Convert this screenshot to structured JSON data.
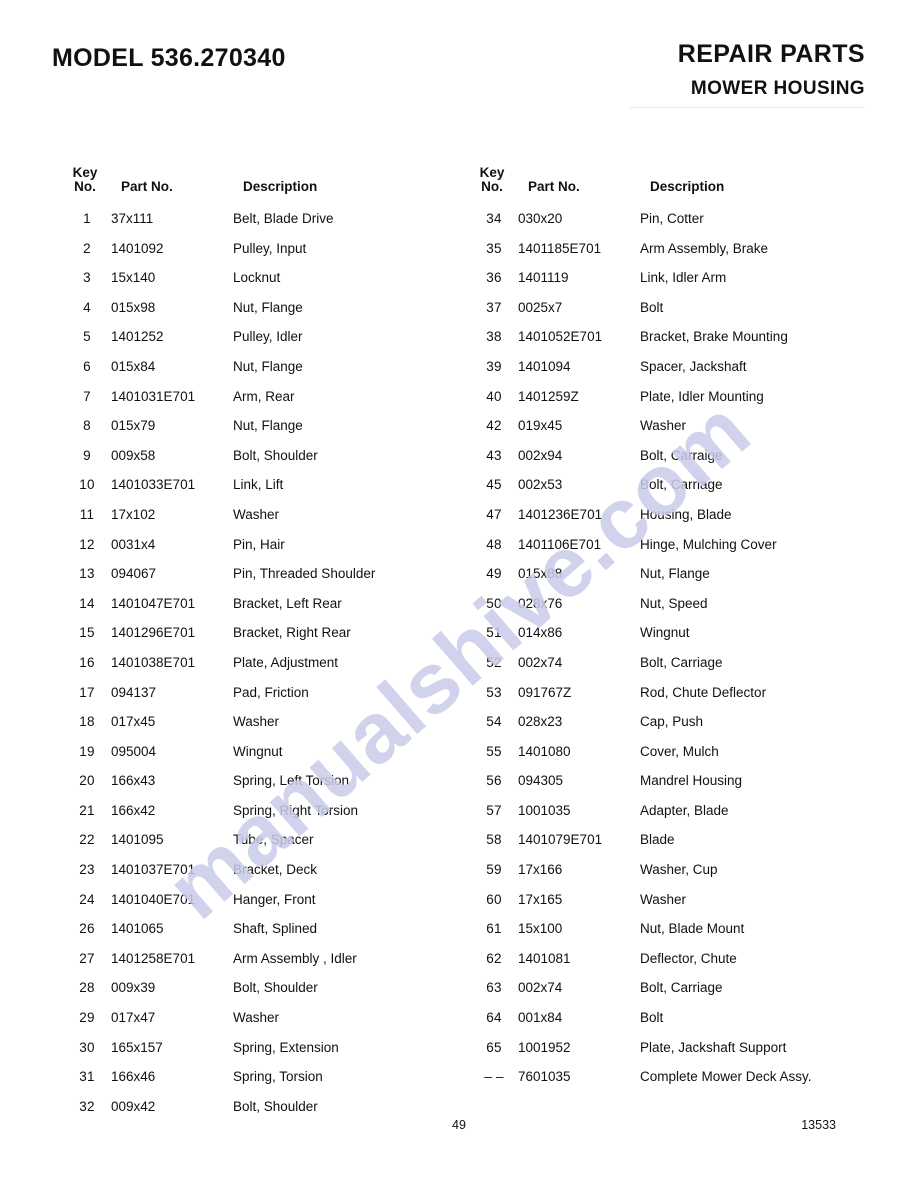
{
  "header": {
    "model_title": "MODEL 536.270340",
    "repair_parts": "REPAIR PARTS",
    "section": "MOWER HOUSING"
  },
  "table": {
    "headers": {
      "key_no": "Key\nNo.",
      "part_no": "Part No.",
      "description": "Description"
    },
    "left_rows": [
      {
        "key": "1",
        "part": "37x111",
        "desc": "Belt, Blade Drive"
      },
      {
        "key": "2",
        "part": "1401092",
        "desc": "Pulley, Input"
      },
      {
        "key": "3",
        "part": "15x140",
        "desc": "Locknut"
      },
      {
        "key": "4",
        "part": "015x98",
        "desc": "Nut, Flange"
      },
      {
        "key": "5",
        "part": "1401252",
        "desc": "Pulley, Idler"
      },
      {
        "key": "6",
        "part": "015x84",
        "desc": "Nut, Flange"
      },
      {
        "key": "7",
        "part": "1401031E701",
        "desc": "Arm, Rear"
      },
      {
        "key": "8",
        "part": "015x79",
        "desc": "Nut, Flange"
      },
      {
        "key": "9",
        "part": "009x58",
        "desc": "Bolt, Shoulder"
      },
      {
        "key": "10",
        "part": "1401033E701",
        "desc": "Link, Lift"
      },
      {
        "key": "11",
        "part": "17x102",
        "desc": "Washer"
      },
      {
        "key": "12",
        "part": "0031x4",
        "desc": "Pin, Hair"
      },
      {
        "key": "13",
        "part": "094067",
        "desc": "Pin, Threaded Shoulder"
      },
      {
        "key": "14",
        "part": "1401047E701",
        "desc": "Bracket, Left Rear"
      },
      {
        "key": "15",
        "part": "1401296E701",
        "desc": "Bracket, Right Rear"
      },
      {
        "key": "16",
        "part": "1401038E701",
        "desc": "Plate, Adjustment"
      },
      {
        "key": "17",
        "part": "094137",
        "desc": "Pad, Friction"
      },
      {
        "key": "18",
        "part": "017x45",
        "desc": "Washer"
      },
      {
        "key": "19",
        "part": "095004",
        "desc": "Wingnut"
      },
      {
        "key": "20",
        "part": "166x43",
        "desc": "Spring, Left Torsion"
      },
      {
        "key": "21",
        "part": "166x42",
        "desc": "Spring, Right Torsion"
      },
      {
        "key": "22",
        "part": "1401095",
        "desc": "Tube, Spacer"
      },
      {
        "key": "23",
        "part": "1401037E701",
        "desc": "Bracket, Deck"
      },
      {
        "key": "24",
        "part": "1401040E701",
        "desc": "Hanger, Front"
      },
      {
        "key": "26",
        "part": "1401065",
        "desc": "Shaft, Splined"
      },
      {
        "key": "27",
        "part": "1401258E701",
        "desc": "Arm Assembly , Idler"
      },
      {
        "key": "28",
        "part": "009x39",
        "desc": "Bolt, Shoulder"
      },
      {
        "key": "29",
        "part": "017x47",
        "desc": "Washer"
      },
      {
        "key": "30",
        "part": "165x157",
        "desc": "Spring, Extension"
      },
      {
        "key": "31",
        "part": "166x46",
        "desc": "Spring, Torsion"
      },
      {
        "key": "32",
        "part": "009x42",
        "desc": "Bolt, Shoulder"
      }
    ],
    "right_rows": [
      {
        "key": "34",
        "part": "030x20",
        "desc": "Pin, Cotter"
      },
      {
        "key": "35",
        "part": "1401185E701",
        "desc": "Arm Assembly, Brake"
      },
      {
        "key": "36",
        "part": "1401119",
        "desc": "Link, Idler Arm"
      },
      {
        "key": "37",
        "part": "0025x7",
        "desc": "Bolt"
      },
      {
        "key": "38",
        "part": "1401052E701",
        "desc": "Bracket, Brake Mounting"
      },
      {
        "key": "39",
        "part": "1401094",
        "desc": "Spacer, Jackshaft"
      },
      {
        "key": "40",
        "part": "1401259Z",
        "desc": "Plate, Idler Mounting"
      },
      {
        "key": "42",
        "part": "019x45",
        "desc": "Washer"
      },
      {
        "key": "43",
        "part": "002x94",
        "desc": "Bolt, Carraige"
      },
      {
        "key": "45",
        "part": "002x53",
        "desc": "Bolt, Carriage"
      },
      {
        "key": "47",
        "part": "1401236E701",
        "desc": "Housing, Blade"
      },
      {
        "key": "48",
        "part": "1401106E701",
        "desc": "Hinge, Mulching Cover"
      },
      {
        "key": "49",
        "part": "015x88",
        "desc": "Nut, Flange"
      },
      {
        "key": "50",
        "part": "028x76",
        "desc": "Nut, Speed"
      },
      {
        "key": "51",
        "part": "014x86",
        "desc": "Wingnut"
      },
      {
        "key": "52",
        "part": "002x74",
        "desc": "Bolt, Carriage"
      },
      {
        "key": "53",
        "part": "091767Z",
        "desc": "Rod, Chute Deflector"
      },
      {
        "key": "54",
        "part": "028x23",
        "desc": "Cap, Push"
      },
      {
        "key": "55",
        "part": "1401080",
        "desc": "Cover, Mulch"
      },
      {
        "key": "56",
        "part": "094305",
        "desc": "Mandrel Housing"
      },
      {
        "key": "57",
        "part": "1001035",
        "desc": "Adapter, Blade"
      },
      {
        "key": "58",
        "part": "1401079E701",
        "desc": "Blade"
      },
      {
        "key": "59",
        "part": "17x166",
        "desc": "Washer, Cup"
      },
      {
        "key": "60",
        "part": "17x165",
        "desc": "Washer"
      },
      {
        "key": "61",
        "part": "15x100",
        "desc": "Nut, Blade Mount"
      },
      {
        "key": "62",
        "part": "1401081",
        "desc": "Deflector, Chute"
      },
      {
        "key": "63",
        "part": "002x74",
        "desc": "Bolt, Carriage"
      },
      {
        "key": "64",
        "part": "001x84",
        "desc": "Bolt"
      },
      {
        "key": "65",
        "part": "1001952",
        "desc": "Plate, Jackshaft Support"
      },
      {
        "key": "– –",
        "part": "7601035",
        "desc": "Complete Mower Deck Assy."
      }
    ]
  },
  "footer": {
    "page_number": "49",
    "doc_code": "13533"
  },
  "watermark": {
    "text": "manualshive.com",
    "color": "#c9cce9"
  },
  "colors": {
    "text": "#111111",
    "background": "#ffffff",
    "rule": "#e6e6ea",
    "watermark": "#c9cce9"
  }
}
